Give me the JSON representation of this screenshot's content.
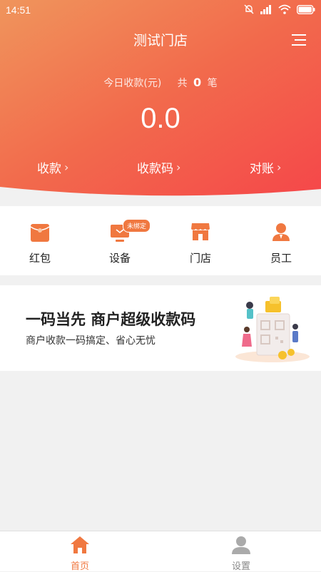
{
  "status_bar": {
    "time": "14:51"
  },
  "header": {
    "title": "测试门店",
    "summary_label": "今日收款(元)",
    "count_prefix": "共",
    "count": "0",
    "count_suffix": "笔",
    "amount": "0.0",
    "actions": [
      {
        "label": "收款"
      },
      {
        "label": "收款码"
      },
      {
        "label": "对账"
      }
    ]
  },
  "quick_entries": [
    {
      "label": "红包",
      "icon": "red-packet-icon"
    },
    {
      "label": "设备",
      "icon": "device-icon",
      "badge": "未绑定"
    },
    {
      "label": "门店",
      "icon": "store-icon"
    },
    {
      "label": "员工",
      "icon": "staff-icon"
    }
  ],
  "banner": {
    "title": "一码当先 商户超级收款码",
    "subtitle": "商户收款一码搞定、省心无忧"
  },
  "tabbar": {
    "items": [
      {
        "label": "首页",
        "icon": "home-icon",
        "active": true
      },
      {
        "label": "设置",
        "icon": "person-icon",
        "active": false
      }
    ]
  },
  "colors": {
    "accent": "#f07840",
    "header_start": "#f0915a",
    "header_end": "#f4484a",
    "inactive": "#888888"
  }
}
